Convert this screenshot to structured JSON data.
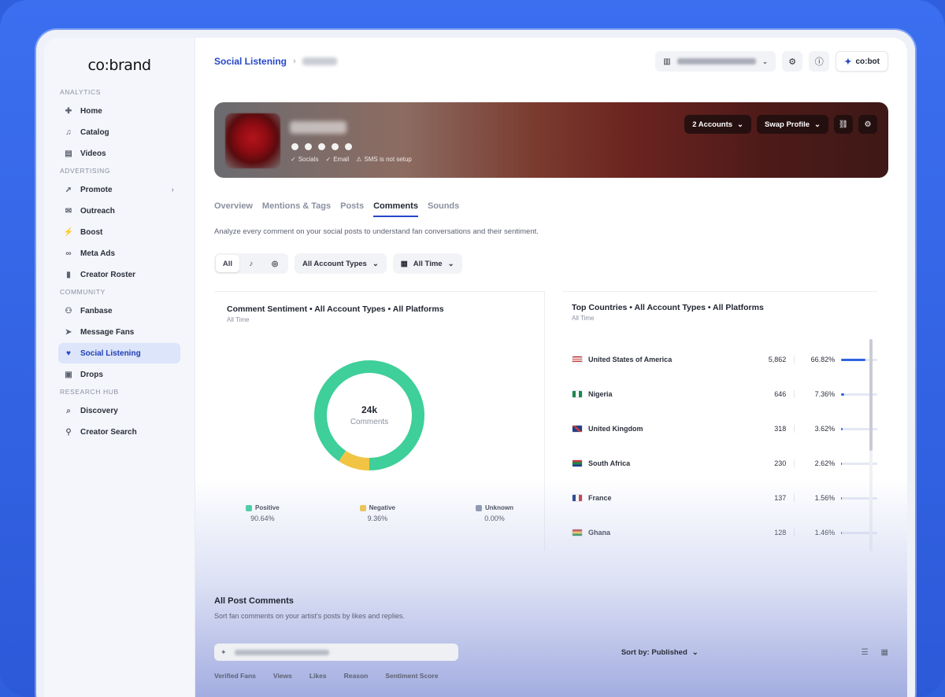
{
  "app": {
    "logo": "co:brand"
  },
  "sidebar": {
    "sections": [
      {
        "title": "ANALYTICS",
        "items": [
          {
            "label": "Home",
            "icon": "home-icon",
            "glyph": "✚"
          },
          {
            "label": "Catalog",
            "icon": "music-note-icon",
            "glyph": "♫"
          },
          {
            "label": "Videos",
            "icon": "video-icon",
            "glyph": "▤"
          }
        ]
      },
      {
        "title": "ADVERTISING",
        "items": [
          {
            "label": "Promote",
            "icon": "rocket-icon",
            "glyph": "➚",
            "chevron": "›"
          },
          {
            "label": "Outreach",
            "icon": "mail-icon",
            "glyph": "✉"
          },
          {
            "label": "Boost",
            "icon": "bolt-icon",
            "glyph": "⚡"
          },
          {
            "label": "Meta Ads",
            "icon": "meta-icon",
            "glyph": "∞"
          },
          {
            "label": "Creator Roster",
            "icon": "bookmark-icon",
            "glyph": "▮"
          }
        ]
      },
      {
        "title": "COMMUNITY",
        "items": [
          {
            "label": "Fanbase",
            "icon": "people-icon",
            "glyph": "⚇"
          },
          {
            "label": "Message Fans",
            "icon": "send-icon",
            "glyph": "➤"
          },
          {
            "label": "Social Listening",
            "icon": "heart-icon",
            "glyph": "♥",
            "active": true
          },
          {
            "label": "Drops",
            "icon": "gift-icon",
            "glyph": "▣"
          }
        ]
      },
      {
        "title": "RESEARCH HUB",
        "items": [
          {
            "label": "Discovery",
            "icon": "discovery-icon",
            "glyph": "⌕"
          },
          {
            "label": "Creator Search",
            "icon": "search-icon",
            "glyph": "⚲"
          }
        ]
      }
    ]
  },
  "header": {
    "breadcrumb_root": "Social Listening",
    "breadcrumb_sep": "›",
    "org_chevron": "⌄",
    "settings_glyph": "⚙",
    "info_glyph": "ⓘ",
    "cobot_label": "co:bot",
    "cobot_glyph": "✦"
  },
  "banner": {
    "accounts_label": "2 Accounts",
    "swap_label": "Swap Profile",
    "chevron": "⌄",
    "link_glyph": "⛓",
    "settings_glyph": "⚙",
    "status": [
      {
        "label": "Socials",
        "glyph": "✓"
      },
      {
        "label": "Email",
        "glyph": "✓"
      },
      {
        "label": "SMS is not setup",
        "glyph": "⚠"
      }
    ]
  },
  "tabs": [
    "Overview",
    "Mentions & Tags",
    "Posts",
    "Comments",
    "Sounds"
  ],
  "active_tab": "Comments",
  "description": "Analyze every comment on your social posts to understand fan conversations and their sentiment.",
  "filters": {
    "segments": [
      {
        "label": "All",
        "active": true
      },
      {
        "label": "♪",
        "icon": "tiktok-icon"
      },
      {
        "label": "◎",
        "icon": "instagram-icon"
      }
    ],
    "account_types": "All Account Types",
    "time_glyph": "▦",
    "time": "All Time",
    "chevron": "⌄"
  },
  "sentiment": {
    "title": "Comment Sentiment • All Account Types • All Platforms",
    "subtitle": "All Time",
    "center_value": "24k",
    "center_label": "Comments",
    "legend": [
      {
        "label": "Positive",
        "value": "90.64%",
        "color": "#3ecf9a",
        "pct": 90.64
      },
      {
        "label": "Negative",
        "value": "9.36%",
        "color": "#f2c443",
        "pct": 9.36
      },
      {
        "label": "Unknown",
        "value": "0.00%",
        "color": "#8792a8",
        "pct": 0
      }
    ]
  },
  "countries": {
    "title": "Top Countries • All Account Types • All Platforms",
    "subtitle": "All Time",
    "rows": [
      {
        "name": "United States of America",
        "count": "5,862",
        "pct": "66.82%",
        "fraction": 0.6682,
        "flag": "us-flag"
      },
      {
        "name": "Nigeria",
        "count": "646",
        "pct": "7.36%",
        "fraction": 0.0736,
        "flag": "ng-flag"
      },
      {
        "name": "United Kingdom",
        "count": "318",
        "pct": "3.62%",
        "fraction": 0.0362,
        "flag": "uk-flag"
      },
      {
        "name": "South Africa",
        "count": "230",
        "pct": "2.62%",
        "fraction": 0.0262,
        "flag": "za-flag"
      },
      {
        "name": "France",
        "count": "137",
        "pct": "1.56%",
        "fraction": 0.0156,
        "flag": "fr-flag"
      },
      {
        "name": "Ghana",
        "count": "128",
        "pct": "1.46%",
        "fraction": 0.0146,
        "flag": "gh-flag"
      }
    ]
  },
  "all_comments": {
    "title": "All Post Comments",
    "subtitle": "Sort fan comments on your artist's posts by likes and replies.",
    "search_glyph": "✦",
    "sort_label": "Sort by: Published",
    "chevron": "⌄",
    "list_view_glyph": "☰",
    "grid_view_glyph": "▦",
    "columns": [
      "Verified Fans",
      "Views",
      "Likes",
      "Reason",
      "Sentiment Score"
    ]
  }
}
